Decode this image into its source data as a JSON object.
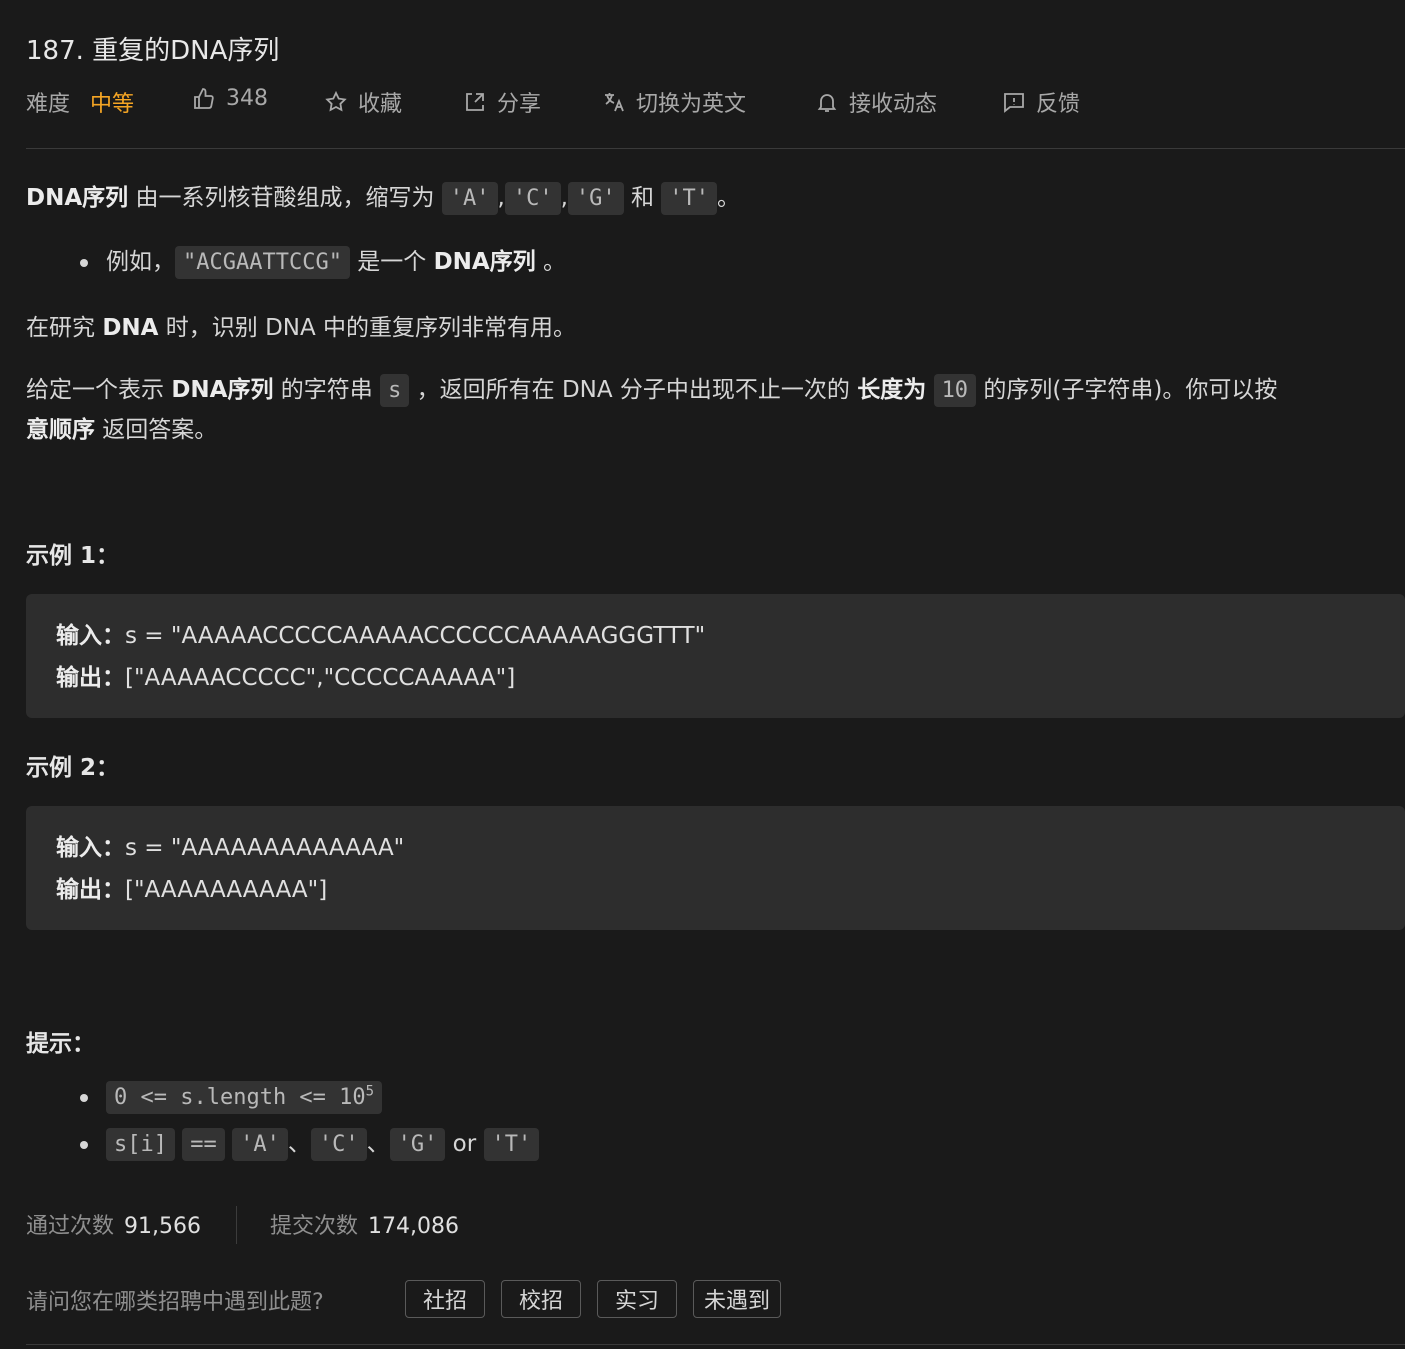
{
  "problem": {
    "title": "187. 重复的DNA序列"
  },
  "meta": {
    "difficulty_label": "难度",
    "difficulty_value": "中等",
    "likes": "348",
    "favorite": "收藏",
    "share": "分享",
    "switch_lang": "切换为英文",
    "subscribe": "接收动态",
    "feedback": "反馈"
  },
  "desc": {
    "p1_bold": "DNA序列",
    "p1_text": " 由一系列核苷酸组成，缩写为 ",
    "codes": [
      "'A'",
      "'C'",
      "'G'",
      "'T'"
    ],
    "p1_sep1": ",",
    "p1_sep2": ",",
    "p1_and": " 和 ",
    "p1_end": "。",
    "bullet_prefix": "例如，",
    "bullet_code": "\"ACGAATTCCG\"",
    "bullet_mid": " 是一个 ",
    "bullet_bold": "DNA序列",
    "bullet_end": " 。",
    "p2_pre": "在研究 ",
    "p2_bold": "DNA",
    "p2_post": " 时，识别 DNA 中的重复序列非常有用。",
    "p3_pre": "给定一个表示 ",
    "p3_bold1": "DNA序列",
    "p3_mid1": " 的字符串 ",
    "p3_code1": "s",
    "p3_mid2": " ，返回所有在 DNA 分子中出现不止一次的 ",
    "p3_bold2": "长度为",
    "p3_code2": "10",
    "p3_mid3": " 的序列(子字符串)。你可以按",
    "p3_bold3": "意顺序",
    "p3_end": " 返回答案。"
  },
  "examples": [
    {
      "heading": "示例 1：",
      "input_label": "输入：",
      "input": "s = \"AAAAACCCCCAAAAACCCCCCAAAAAGGGTTT\"",
      "output_label": "输出：",
      "output": "[\"AAAAACCCCC\",\"CCCCCAAAAA\"]"
    },
    {
      "heading": "示例 2：",
      "input_label": "输入：",
      "input": "s = \"AAAAAAAAAAAAA\"",
      "output_label": "输出：",
      "output": "[\"AAAAAAAAAA\"]"
    }
  ],
  "hints": {
    "heading": "提示：",
    "c1_pre": "0 <= s.length <= 10",
    "c1_sup": "5",
    "c2_code1": "s[i]",
    "c2_code2": "==",
    "c2_codes": [
      "'A'",
      "'C'",
      "'G'",
      "'T'"
    ],
    "c2_sep": "、",
    "c2_or": " or "
  },
  "stats": {
    "accepted_label": "通过次数",
    "accepted_value": "91,566",
    "submissions_label": "提交次数",
    "submissions_value": "174,086"
  },
  "survey": {
    "question": "请问您在哪类招聘中遇到此题?",
    "options": [
      "社招",
      "校招",
      "实习",
      "未遇到"
    ]
  }
}
